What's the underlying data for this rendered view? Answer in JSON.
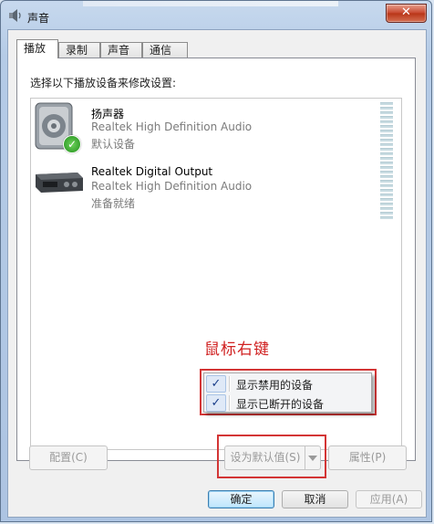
{
  "window": {
    "title": "声音",
    "close_label": "✕"
  },
  "tabs": [
    "播放",
    "录制",
    "声音",
    "通信"
  ],
  "instruction": "选择以下播放设备来修改设置:",
  "devices": [
    {
      "name": "扬声器",
      "description": "Realtek High Definition Audio",
      "status": "默认设备",
      "icon": "speaker-icon",
      "is_default": true
    },
    {
      "name": "Realtek Digital Output",
      "description": "Realtek High Definition Audio",
      "status": "准备就绪",
      "icon": "digital-output-icon",
      "is_default": false
    }
  ],
  "annotation": "鼠标右键",
  "context_menu": {
    "items": [
      {
        "label": "显示禁用的设备",
        "checked": true,
        "check_glyph": "✓"
      },
      {
        "label": "显示已断开的设备",
        "checked": true,
        "check_glyph": "✓"
      }
    ]
  },
  "panel_buttons": {
    "configure": "配置(C)",
    "set_default": "设为默认值(S)",
    "properties": "属性(P)"
  },
  "footer_buttons": {
    "ok": "确定",
    "cancel": "取消",
    "apply": "应用(A)"
  },
  "colors": {
    "annotation_red": "#d02020",
    "accent": "#3c7fb1"
  }
}
